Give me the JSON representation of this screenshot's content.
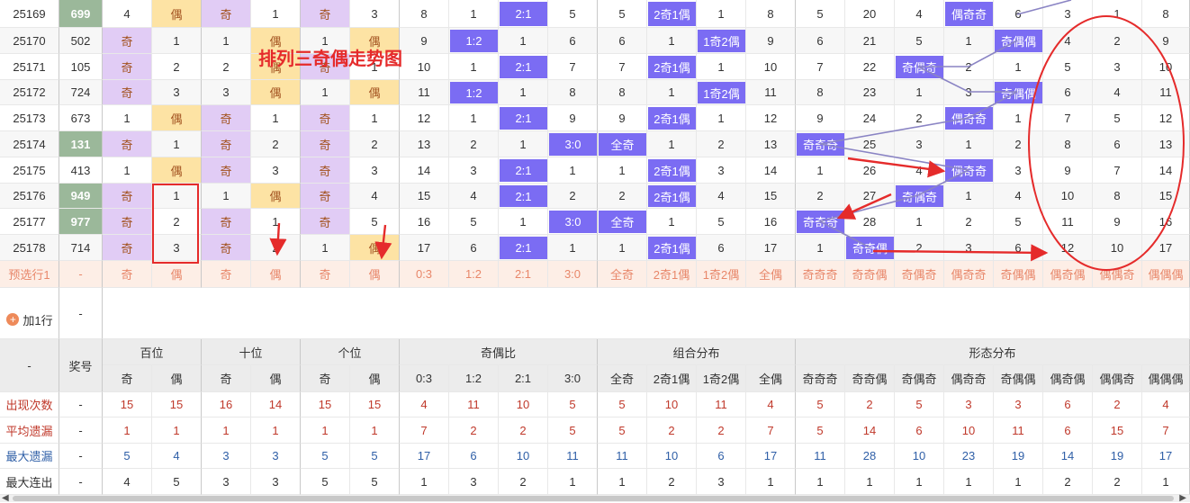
{
  "title_overlay": "排列三奇偶走势图",
  "add_row_label": "加1行",
  "add_row_value": "-",
  "colors": {
    "odd_purple": "#e1ccf5",
    "even_yellow": "#fde3a4",
    "ratio_blue": "#7b6cf3",
    "award_green": "#9bb89a",
    "predict_bg": "#fdeee6",
    "predict_text": "#e8876a",
    "annotation_red": "#e52b2b",
    "line_purple": "#8a84c4"
  },
  "rows": [
    {
      "issue": "25169",
      "award": "699",
      "award_hl": true,
      "h": [
        "4",
        "偶"
      ],
      "t": [
        "奇",
        "1"
      ],
      "g": [
        "奇",
        "3"
      ],
      "r": [
        "8",
        "1",
        "2:1",
        "5"
      ],
      "z": [
        "5",
        "2奇1偶",
        "1",
        "8"
      ],
      "f": [
        "5",
        "20",
        "4",
        "偶奇奇",
        "6",
        "3",
        "1",
        "8"
      ]
    },
    {
      "issue": "25170",
      "award": "502",
      "award_hl": false,
      "h": [
        "奇",
        "1"
      ],
      "t": [
        "1",
        "偶"
      ],
      "g": [
        "1",
        "偶"
      ],
      "r": [
        "9",
        "1:2",
        "1",
        "6"
      ],
      "z": [
        "6",
        "1",
        "1奇2偶",
        "9"
      ],
      "f": [
        "6",
        "21",
        "5",
        "1",
        "奇偶偶",
        "4",
        "2",
        "9"
      ]
    },
    {
      "issue": "25171",
      "award": "105",
      "award_hl": false,
      "h": [
        "奇",
        "2"
      ],
      "t": [
        "2",
        "偶"
      ],
      "g": [
        "奇",
        "1"
      ],
      "r": [
        "10",
        "1",
        "2:1",
        "7"
      ],
      "z": [
        "7",
        "2奇1偶",
        "1",
        "10"
      ],
      "f": [
        "7",
        "22",
        "奇偶奇",
        "2",
        "1",
        "5",
        "3",
        "10"
      ]
    },
    {
      "issue": "25172",
      "award": "724",
      "award_hl": false,
      "h": [
        "奇",
        "3"
      ],
      "t": [
        "3",
        "偶"
      ],
      "g": [
        "1",
        "偶"
      ],
      "r": [
        "11",
        "1:2",
        "1",
        "8"
      ],
      "z": [
        "8",
        "1",
        "1奇2偶",
        "11"
      ],
      "f": [
        "8",
        "23",
        "1",
        "3",
        "奇偶偶",
        "6",
        "4",
        "11"
      ]
    },
    {
      "issue": "25173",
      "award": "673",
      "award_hl": false,
      "h": [
        "1",
        "偶"
      ],
      "t": [
        "奇",
        "1"
      ],
      "g": [
        "奇",
        "1"
      ],
      "r": [
        "12",
        "1",
        "2:1",
        "9"
      ],
      "z": [
        "9",
        "2奇1偶",
        "1",
        "12"
      ],
      "f": [
        "9",
        "24",
        "2",
        "偶奇奇",
        "1",
        "7",
        "5",
        "12"
      ]
    },
    {
      "issue": "25174",
      "award": "131",
      "award_hl": true,
      "h": [
        "奇",
        "1"
      ],
      "t": [
        "奇",
        "2"
      ],
      "g": [
        "奇",
        "2"
      ],
      "r": [
        "13",
        "2",
        "1",
        "3:0"
      ],
      "z": [
        "全奇",
        "1",
        "2",
        "13"
      ],
      "f": [
        "奇奇奇",
        "25",
        "3",
        "1",
        "2",
        "8",
        "6",
        "13"
      ]
    },
    {
      "issue": "25175",
      "award": "413",
      "award_hl": false,
      "h": [
        "1",
        "偶"
      ],
      "t": [
        "奇",
        "3"
      ],
      "g": [
        "奇",
        "3"
      ],
      "r": [
        "14",
        "3",
        "2:1",
        "1"
      ],
      "z": [
        "1",
        "2奇1偶",
        "3",
        "14"
      ],
      "f": [
        "1",
        "26",
        "4",
        "偶奇奇",
        "3",
        "9",
        "7",
        "14"
      ]
    },
    {
      "issue": "25176",
      "award": "949",
      "award_hl": true,
      "h": [
        "奇",
        "1"
      ],
      "t": [
        "1",
        "偶"
      ],
      "g": [
        "奇",
        "4"
      ],
      "r": [
        "15",
        "4",
        "2:1",
        "2"
      ],
      "z": [
        "2",
        "2奇1偶",
        "4",
        "15"
      ],
      "f": [
        "2",
        "27",
        "奇偶奇",
        "1",
        "4",
        "10",
        "8",
        "15"
      ]
    },
    {
      "issue": "25177",
      "award": "977",
      "award_hl": true,
      "h": [
        "奇",
        "2"
      ],
      "t": [
        "奇",
        "1"
      ],
      "g": [
        "奇",
        "5"
      ],
      "r": [
        "16",
        "5",
        "1",
        "3:0"
      ],
      "z": [
        "全奇",
        "1",
        "5",
        "16"
      ],
      "f": [
        "奇奇奇",
        "28",
        "1",
        "2",
        "5",
        "11",
        "9",
        "16"
      ]
    },
    {
      "issue": "25178",
      "award": "714",
      "award_hl": false,
      "h": [
        "奇",
        "3"
      ],
      "t": [
        "奇",
        "2"
      ],
      "g": [
        "1",
        "偶"
      ],
      "r": [
        "17",
        "6",
        "2:1",
        "1"
      ],
      "z": [
        "1",
        "2奇1偶",
        "6",
        "17"
      ],
      "f": [
        "1",
        "奇奇偶",
        "2",
        "3",
        "6",
        "12",
        "10",
        "17"
      ]
    }
  ],
  "predict": {
    "label": "预选行1",
    "award": "-",
    "cells": [
      "奇",
      "偶",
      "奇",
      "偶",
      "奇",
      "偶",
      "0:3",
      "1:2",
      "2:1",
      "3:0",
      "全奇",
      "2奇1偶",
      "1奇2偶",
      "全偶",
      "奇奇奇",
      "奇奇偶",
      "奇偶奇",
      "偶奇奇",
      "奇偶偶",
      "偶奇偶",
      "偶偶奇",
      "偶偶偶"
    ]
  },
  "header": {
    "corner": "-",
    "award_label": "奖号",
    "groups": [
      "百位",
      "十位",
      "个位",
      "奇偶比",
      "组合分布",
      "形态分布"
    ],
    "subs": [
      "奇",
      "偶",
      "奇",
      "偶",
      "奇",
      "偶",
      "0:3",
      "1:2",
      "2:1",
      "3:0",
      "全奇",
      "2奇1偶",
      "1奇2偶",
      "全偶",
      "奇奇奇",
      "奇奇偶",
      "奇偶奇",
      "偶奇奇",
      "奇偶偶",
      "偶奇偶",
      "偶偶奇",
      "偶偶偶"
    ]
  },
  "stats": [
    {
      "label": "出现次数",
      "award": "-",
      "values": [
        "15",
        "15",
        "16",
        "14",
        "15",
        "15",
        "4",
        "11",
        "10",
        "5",
        "5",
        "10",
        "11",
        "4",
        "5",
        "2",
        "5",
        "3",
        "3",
        "6",
        "2",
        "4"
      ]
    },
    {
      "label": "平均遗漏",
      "award": "-",
      "values": [
        "1",
        "1",
        "1",
        "1",
        "1",
        "1",
        "7",
        "2",
        "2",
        "5",
        "5",
        "2",
        "2",
        "7",
        "5",
        "14",
        "6",
        "10",
        "11",
        "6",
        "15",
        "7"
      ]
    },
    {
      "label": "最大遗漏",
      "award": "-",
      "values": [
        "5",
        "4",
        "3",
        "3",
        "5",
        "5",
        "17",
        "6",
        "10",
        "11",
        "11",
        "10",
        "6",
        "17",
        "11",
        "28",
        "10",
        "23",
        "19",
        "14",
        "19",
        "17"
      ]
    },
    {
      "label": "最大连出",
      "award": "-",
      "values": [
        "4",
        "5",
        "3",
        "3",
        "5",
        "5",
        "1",
        "3",
        "2",
        "1",
        "1",
        "2",
        "3",
        "1",
        "1",
        "1",
        "1",
        "1",
        "1",
        "2",
        "2",
        "1"
      ]
    }
  ]
}
